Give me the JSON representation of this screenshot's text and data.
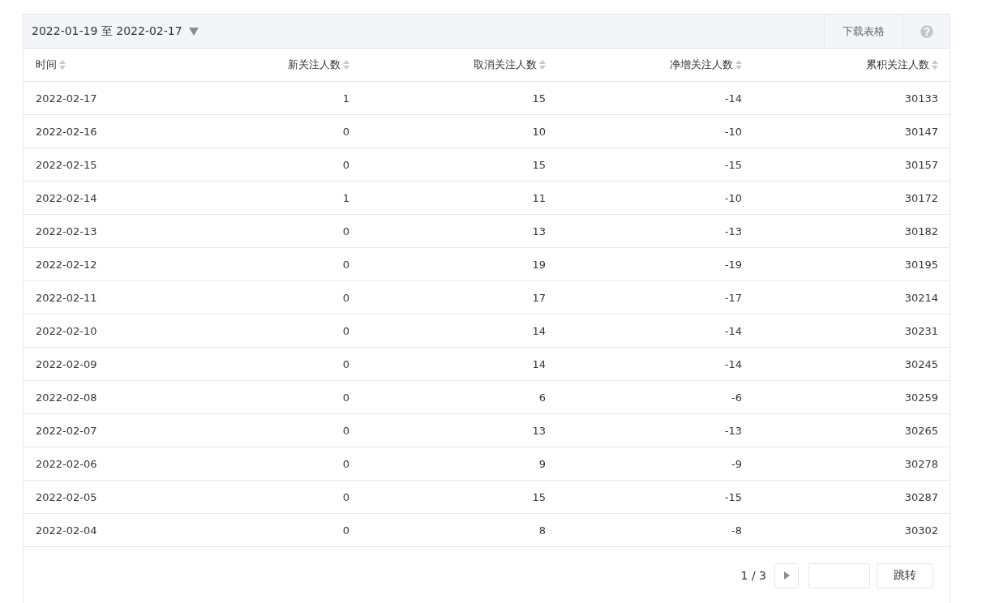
{
  "toolbar": {
    "date_range": "2022-01-19 至 2022-02-17",
    "download_button": "下载表格"
  },
  "table": {
    "columns": [
      "时间",
      "新关注人数",
      "取消关注人数",
      "净增关注人数",
      "累积关注人数"
    ],
    "rows": [
      [
        "2022-02-17",
        "1",
        "15",
        "-14",
        "30133"
      ],
      [
        "2022-02-16",
        "0",
        "10",
        "-10",
        "30147"
      ],
      [
        "2022-02-15",
        "0",
        "15",
        "-15",
        "30157"
      ],
      [
        "2022-02-14",
        "1",
        "11",
        "-10",
        "30172"
      ],
      [
        "2022-02-13",
        "0",
        "13",
        "-13",
        "30182"
      ],
      [
        "2022-02-12",
        "0",
        "19",
        "-19",
        "30195"
      ],
      [
        "2022-02-11",
        "0",
        "17",
        "-17",
        "30214"
      ],
      [
        "2022-02-10",
        "0",
        "14",
        "-14",
        "30231"
      ],
      [
        "2022-02-09",
        "0",
        "14",
        "-14",
        "30245"
      ],
      [
        "2022-02-08",
        "0",
        "6",
        "-6",
        "30259"
      ],
      [
        "2022-02-07",
        "0",
        "13",
        "-13",
        "30265"
      ],
      [
        "2022-02-06",
        "0",
        "9",
        "-9",
        "30278"
      ],
      [
        "2022-02-05",
        "0",
        "15",
        "-15",
        "30287"
      ],
      [
        "2022-02-04",
        "0",
        "8",
        "-8",
        "30302"
      ]
    ]
  },
  "pagination": {
    "page": "1 / 3",
    "jump_button": "跳转"
  }
}
